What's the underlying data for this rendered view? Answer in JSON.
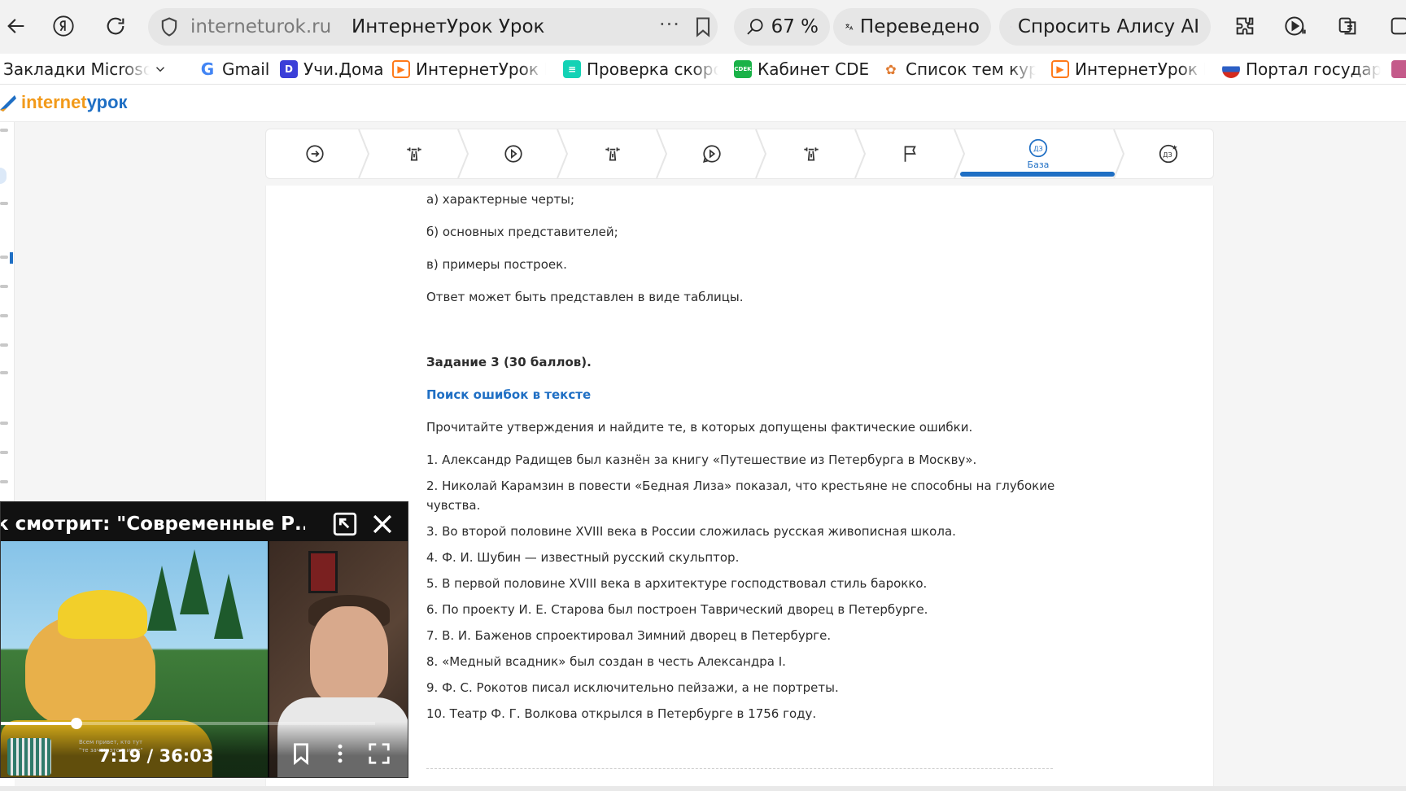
{
  "browser": {
    "address_host": "interneturok.ru",
    "page_title": "ИнтернетУрок Урок",
    "more_dots": "···",
    "zoom": "67 %",
    "translated_label": "Переведено",
    "alice_label": "Спросить Алису AI"
  },
  "bookmarks": [
    {
      "label": "Закладки Microsoft E",
      "icon": "folder-icon"
    },
    {
      "label": "Gmail",
      "icon": "google-icon",
      "color": "#4285f4"
    },
    {
      "label": "Учи.Дома",
      "icon": "uchi-icon",
      "color": "#3b3fd8"
    },
    {
      "label": "ИнтернетУрок Ра",
      "icon": "play-icon",
      "color": "#ff7a1a"
    },
    {
      "label": "Проверка скорос",
      "icon": "speedtest-icon",
      "color": "#13d2b5"
    },
    {
      "label": "Кабинет CDEK",
      "icon": "cdek-icon",
      "color": "#1ab248"
    },
    {
      "label": "Список тем курса",
      "icon": "course-icon",
      "color": "#e07a30"
    },
    {
      "label": "ИнтернетУрок Ра",
      "icon": "play-icon",
      "color": "#ff7a1a"
    },
    {
      "label": "Портал государст",
      "icon": "gosuslugi-icon",
      "color": "#2c5fc5"
    }
  ],
  "site": {
    "logo_part1": "internet",
    "logo_part2": "урок"
  },
  "steps": {
    "active_label": "База",
    "active_badge": "ДЗ",
    "last_badge": "ДЗ"
  },
  "content": {
    "lines": [
      "а) характерные черты;",
      "б) основных представителей;",
      "в) примеры построек.",
      "Ответ может быть представлен в виде таблицы."
    ],
    "task_title": "Задание 3 (30 баллов).",
    "task_subtitle": "Поиск ошибок в тексте",
    "task_intro": "Прочитайте утверждения и найдите те, в которых допущены фактические ошибки.",
    "statements": [
      "1. Александр Радищев был казнён за книгу «Путешествие из Петербурга в Москву».",
      "2. Николай Карамзин в повести «Бедная Лиза» показал, что крестьяне не способны на глубокие",
      "чувства.",
      "3. Во второй половине XVIII века в России сложилась русская живописная школа.",
      "4. Ф. И. Шубин — известный русский скульптор.",
      "5. В первой половине XVIII века в архитектуре господствовал стиль барокко.",
      "6. По проекту И. Е. Старова был построен Таврический дворец в Петербурге.",
      "7. В. И. Баженов спроектировал Зимний дворец в Петербурге.",
      "8. «Медный всадник» был создан в честь Александра I.",
      "9. Ф. С. Рокотов писал исключительно пейзажи, а не портреты.",
      "10. Театр Ф. Г. Волкова открылся в Петербурге в 1756 году."
    ]
  },
  "player": {
    "title": "к смотрит: \"Современные Р...",
    "time": "7:19 / 36:03",
    "progress_fraction": 0.203,
    "chat_line1": "Всем привет, кто тут",
    "chat_line2": "\"те зачем это в игре\""
  }
}
